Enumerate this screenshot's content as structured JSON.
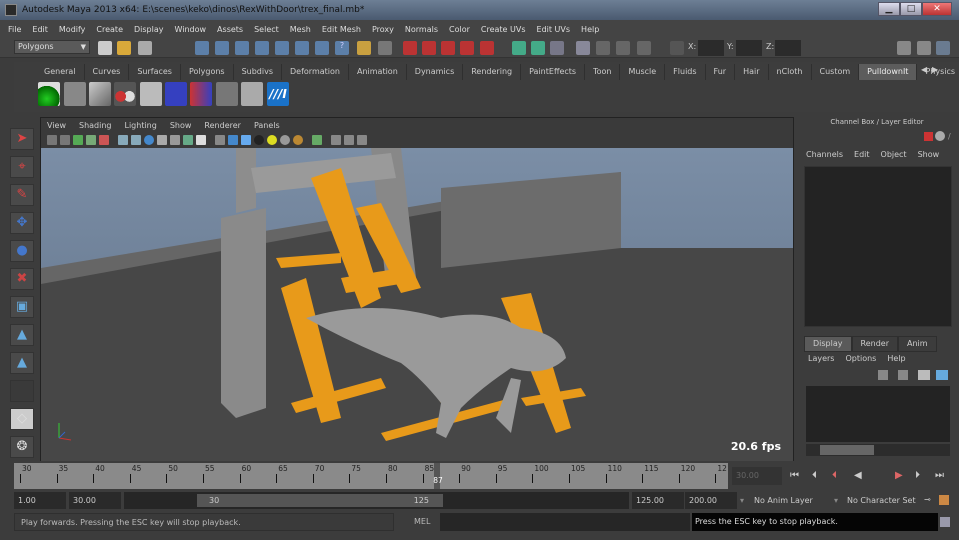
{
  "window": {
    "title": "Autodesk Maya 2013 x64: E:\\scenes\\keko\\dinos\\RexWithDoor\\trex_final.mb*",
    "minimize": "▁",
    "maximize": "□",
    "close": "✕"
  },
  "menubar": [
    "File",
    "Edit",
    "Modify",
    "Create",
    "Display",
    "Window",
    "Assets",
    "Select",
    "Mesh",
    "Edit Mesh",
    "Proxy",
    "Normals",
    "Color",
    "Create UVs",
    "Edit UVs",
    "Help"
  ],
  "toolbar": {
    "menuset": "Polygons",
    "x_label": "X:",
    "y_label": "Y:",
    "z_label": "Z:",
    "x_value": "",
    "y_value": "",
    "z_value": ""
  },
  "shelf": {
    "tabs": [
      "General",
      "Curves",
      "Surfaces",
      "Polygons",
      "Subdivs",
      "Deformation",
      "Animation",
      "Dynamics",
      "Rendering",
      "PaintEffects",
      "Toon",
      "Muscle",
      "Fluids",
      "Fur",
      "Hair",
      "nCloth",
      "Custom",
      "PulldownIt",
      "Physics"
    ],
    "active_tab": "PulldownIt",
    "logo_text": "///I"
  },
  "viewport": {
    "menu": [
      "View",
      "Shading",
      "Lighting",
      "Show",
      "Renderer",
      "Panels"
    ],
    "fps": "20.6 fps",
    "colors": {
      "shards": "#e89a1a",
      "floor": "#4d4d4d",
      "wall": "#6a6a6a",
      "sky": "#6d7f95"
    }
  },
  "channel_box": {
    "title": "Channel Box / Layer Editor",
    "menu": [
      "Channels",
      "Edit",
      "Object",
      "Show"
    ]
  },
  "layer_editor": {
    "tabs": [
      "Display",
      "Render",
      "Anim"
    ],
    "active_tab": "Display",
    "menu": [
      "Layers",
      "Options",
      "Help"
    ]
  },
  "timeline": {
    "ticks": [
      "30",
      "35",
      "40",
      "45",
      "50",
      "55",
      "60",
      "65",
      "70",
      "75",
      "80",
      "85",
      "90",
      "95",
      "100",
      "105",
      "110",
      "115",
      "120",
      "12"
    ],
    "current_frame": "87",
    "current_field": "30.00"
  },
  "range": {
    "start": "1.00",
    "playback_start": "30.00",
    "slider_start": "30",
    "slider_end": "125",
    "playback_end": "125.00",
    "end": "200.00",
    "anim_layer": "No Anim Layer",
    "character_set": "No Character Set"
  },
  "status": {
    "help_line": "Play forwards. Pressing the ESC key will stop playback.",
    "mel_label": "MEL",
    "output": "Press the ESC key to stop playback."
  }
}
